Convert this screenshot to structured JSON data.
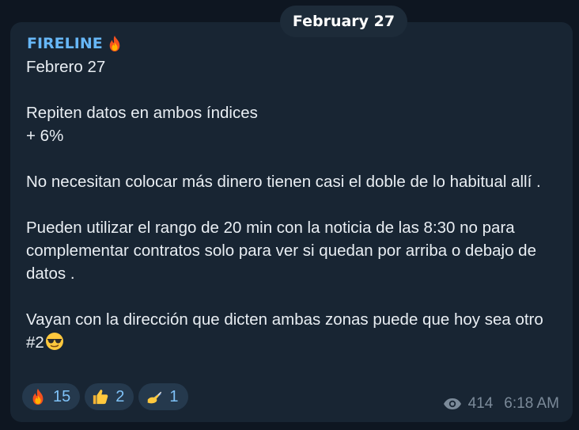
{
  "date_separator": "February 27",
  "message": {
    "author": "FIRELINE",
    "author_icon": "fire-emoji",
    "lines": {
      "l1": "Febrero 27",
      "l2": "Repiten datos en ambos índices",
      "l3": "+ 6%",
      "l4": "No necesitan colocar más dinero tienen casi el doble de lo habitual allí .",
      "l5": "Pueden utilizar el rango de 20 min con la noticia de las 8:30 no para complementar contratos solo para ver si quedan por arriba o debajo de datos  .",
      "l6": "Vayan con la dirección que dicten ambas zonas puede que hoy sea otro #2"
    },
    "trailing_emoji": "sunglasses-emoji",
    "reactions": [
      {
        "emoji": "fire-emoji",
        "count": "15"
      },
      {
        "emoji": "thumbs-up-emoji",
        "count": "2"
      },
      {
        "emoji": "writing-hand-emoji",
        "count": "1"
      }
    ],
    "views": "414",
    "time": "6:18 AM"
  },
  "colors": {
    "background": "#0e1621",
    "bubble": "#182533",
    "author": "#67b7f7",
    "text": "#e9eef3",
    "reaction_bg": "#25394d",
    "reaction_count": "#7fc2f8",
    "meta": "#7b8a99"
  }
}
